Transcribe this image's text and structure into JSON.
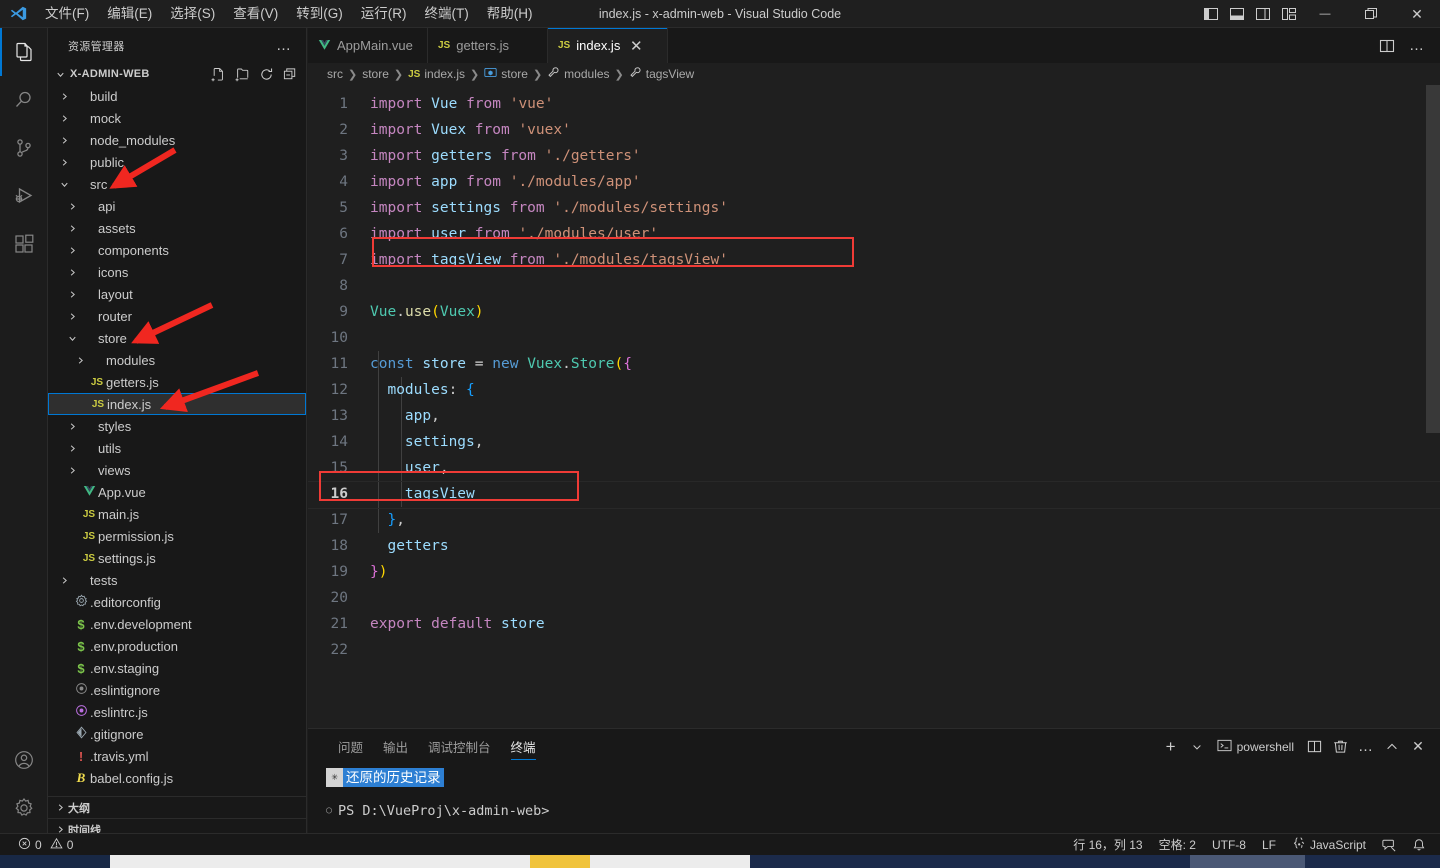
{
  "window": {
    "title": "index.js - x-admin-web - Visual Studio Code",
    "minimize": "—",
    "restore": "❐",
    "close": "✕"
  },
  "menu": {
    "items": [
      {
        "label": "文件(F)"
      },
      {
        "label": "编辑(E)"
      },
      {
        "label": "选择(S)"
      },
      {
        "label": "查看(V)"
      },
      {
        "label": "转到(G)"
      },
      {
        "label": "运行(R)"
      },
      {
        "label": "终端(T)"
      },
      {
        "label": "帮助(H)"
      }
    ]
  },
  "layout_toggles": [
    {
      "name": "toggle-primary-sidebar-icon"
    },
    {
      "name": "toggle-panel-icon"
    },
    {
      "name": "toggle-secondary-sidebar-icon"
    },
    {
      "name": "customize-layout-icon"
    }
  ],
  "activitybar": {
    "items": [
      {
        "name": "explorer",
        "icon": "files-icon",
        "active": true
      },
      {
        "name": "search",
        "icon": "search-icon",
        "active": false
      },
      {
        "name": "source-control",
        "icon": "source-control-icon",
        "active": false
      },
      {
        "name": "run-debug",
        "icon": "run-debug-icon",
        "active": false
      },
      {
        "name": "extensions",
        "icon": "extensions-icon",
        "active": false
      }
    ],
    "bottom": [
      {
        "name": "accounts",
        "icon": "account-icon"
      },
      {
        "name": "manage",
        "icon": "gear-icon"
      }
    ]
  },
  "sidebar": {
    "title": "资源管理器",
    "more_actions": "…",
    "root": {
      "label": "X-ADMIN-WEB",
      "expanded": true,
      "actions": [
        "new-file-icon",
        "new-folder-icon",
        "refresh-icon",
        "collapse-all-icon"
      ]
    },
    "tree": [
      {
        "label": "build",
        "type": "folder",
        "depth": 1,
        "expanded": false
      },
      {
        "label": "mock",
        "type": "folder",
        "depth": 1,
        "expanded": false
      },
      {
        "label": "node_modules",
        "type": "folder",
        "depth": 1,
        "expanded": false
      },
      {
        "label": "public",
        "type": "folder",
        "depth": 1,
        "expanded": false
      },
      {
        "label": "src",
        "type": "folder",
        "depth": 1,
        "expanded": true
      },
      {
        "label": "api",
        "type": "folder",
        "depth": 2,
        "expanded": false
      },
      {
        "label": "assets",
        "type": "folder",
        "depth": 2,
        "expanded": false
      },
      {
        "label": "components",
        "type": "folder",
        "depth": 2,
        "expanded": false
      },
      {
        "label": "icons",
        "type": "folder",
        "depth": 2,
        "expanded": false
      },
      {
        "label": "layout",
        "type": "folder",
        "depth": 2,
        "expanded": false
      },
      {
        "label": "router",
        "type": "folder",
        "depth": 2,
        "expanded": false
      },
      {
        "label": "store",
        "type": "folder",
        "depth": 2,
        "expanded": true
      },
      {
        "label": "modules",
        "type": "folder",
        "depth": 3,
        "expanded": false
      },
      {
        "label": "getters.js",
        "type": "js",
        "depth": 3
      },
      {
        "label": "index.js",
        "type": "js",
        "depth": 3,
        "selected": true
      },
      {
        "label": "styles",
        "type": "folder",
        "depth": 2,
        "expanded": false
      },
      {
        "label": "utils",
        "type": "folder",
        "depth": 2,
        "expanded": false
      },
      {
        "label": "views",
        "type": "folder",
        "depth": 2,
        "expanded": false
      },
      {
        "label": "App.vue",
        "type": "vue",
        "depth": 2
      },
      {
        "label": "main.js",
        "type": "js",
        "depth": 2
      },
      {
        "label": "permission.js",
        "type": "js",
        "depth": 2
      },
      {
        "label": "settings.js",
        "type": "js",
        "depth": 2
      },
      {
        "label": "tests",
        "type": "folder",
        "depth": 1,
        "expanded": false
      },
      {
        "label": ".editorconfig",
        "type": "config",
        "depth": 1
      },
      {
        "label": ".env.development",
        "type": "env",
        "depth": 1
      },
      {
        "label": ".env.production",
        "type": "env",
        "depth": 1
      },
      {
        "label": ".env.staging",
        "type": "env",
        "depth": 1
      },
      {
        "label": ".eslintignore",
        "type": "eslintignore",
        "depth": 1
      },
      {
        "label": ".eslintrc.js",
        "type": "eslint",
        "depth": 1
      },
      {
        "label": ".gitignore",
        "type": "git",
        "depth": 1
      },
      {
        "label": ".travis.yml",
        "type": "travis",
        "depth": 1
      },
      {
        "label": "babel.config.js",
        "type": "babel",
        "depth": 1
      }
    ],
    "bottom_sections": [
      {
        "label": "大纲"
      },
      {
        "label": "时间线"
      }
    ]
  },
  "tabs": [
    {
      "label": "AppMain.vue",
      "type": "vue",
      "active": false
    },
    {
      "label": "getters.js",
      "type": "js",
      "active": false
    },
    {
      "label": "index.js",
      "type": "js",
      "active": true,
      "close": "✕"
    }
  ],
  "tabbar_actions": [
    {
      "name": "split-editor-icon"
    },
    {
      "name": "more-actions-icon",
      "label": "…"
    }
  ],
  "breadcrumb": [
    {
      "label": "src",
      "icon": ""
    },
    {
      "label": "store",
      "icon": ""
    },
    {
      "label": "index.js",
      "icon": "js"
    },
    {
      "label": "store",
      "icon": "module"
    },
    {
      "label": "modules",
      "icon": "property"
    },
    {
      "label": "tagsView",
      "icon": "property"
    }
  ],
  "editor": {
    "active_line": 16,
    "lines": [
      {
        "n": 1,
        "text": "import Vue from 'vue'"
      },
      {
        "n": 2,
        "text": "import Vuex from 'vuex'"
      },
      {
        "n": 3,
        "text": "import getters from './getters'"
      },
      {
        "n": 4,
        "text": "import app from './modules/app'"
      },
      {
        "n": 5,
        "text": "import settings from './modules/settings'"
      },
      {
        "n": 6,
        "text": "import user from './modules/user'"
      },
      {
        "n": 7,
        "text": "import tagsView from './modules/tagsView'"
      },
      {
        "n": 8,
        "text": ""
      },
      {
        "n": 9,
        "text": "Vue.use(Vuex)"
      },
      {
        "n": 10,
        "text": ""
      },
      {
        "n": 11,
        "text": "const store = new Vuex.Store({"
      },
      {
        "n": 12,
        "text": "  modules: {"
      },
      {
        "n": 13,
        "text": "    app,"
      },
      {
        "n": 14,
        "text": "    settings,"
      },
      {
        "n": 15,
        "text": "    user,"
      },
      {
        "n": 16,
        "text": "    tagsView"
      },
      {
        "n": 17,
        "text": "  },"
      },
      {
        "n": 18,
        "text": "  getters"
      },
      {
        "n": 19,
        "text": "})"
      },
      {
        "n": 20,
        "text": ""
      },
      {
        "n": 21,
        "text": "export default store"
      },
      {
        "n": 22,
        "text": ""
      }
    ]
  },
  "annotations": {
    "highlight_boxes": [
      {
        "name": "import-tagsview-highlight",
        "line": 7
      },
      {
        "name": "modules-tagsview-highlight",
        "line": 16
      }
    ],
    "arrows": [
      {
        "name": "arrow-to-src"
      },
      {
        "name": "arrow-to-store"
      },
      {
        "name": "arrow-to-index-js"
      }
    ],
    "color": "#ef3b36"
  },
  "panel": {
    "tabs": [
      {
        "label": "问题",
        "active": false
      },
      {
        "label": "输出",
        "active": false
      },
      {
        "label": "调试控制台",
        "active": false
      },
      {
        "label": "终端",
        "active": true
      }
    ],
    "actions": {
      "new_terminal": "+",
      "dropdown": "⌄",
      "terminal_name": "powershell",
      "split": "split-terminal-icon",
      "kill": "trash-icon",
      "more": "…",
      "maximize": "⌃",
      "close": "✕"
    },
    "terminal": {
      "history_badge_icon": "✳",
      "history_badge_text": "还原的历史记录",
      "prompt": "PS D:\\VueProj\\x-admin-web>"
    }
  },
  "statusbar": {
    "left": [
      {
        "name": "error-count",
        "icon": "error-icon",
        "label": "0"
      },
      {
        "name": "warning-count",
        "icon": "warning-icon",
        "label": "0"
      }
    ],
    "right": [
      {
        "name": "cursor-position",
        "label": "行 16，列 13"
      },
      {
        "name": "indentation",
        "label": "空格: 2"
      },
      {
        "name": "encoding",
        "label": "UTF-8"
      },
      {
        "name": "eol",
        "label": "LF"
      },
      {
        "name": "language-mode",
        "label": "JavaScript",
        "icon": "brace-icon"
      },
      {
        "name": "feedback",
        "icon": "feedback-icon",
        "label": ""
      },
      {
        "name": "notifications",
        "icon": "bell-icon",
        "label": ""
      }
    ]
  },
  "colors": {
    "accent": "#0078d4",
    "annotation_red": "#ef3b36",
    "editor_bg": "#1f1f1f",
    "sidebar_bg": "#181818",
    "keyword": "#c586c0",
    "identifier": "#9cdcfe",
    "string": "#ce9178",
    "function": "#dcdcaa",
    "class": "#4ec9b0",
    "control": "#569cd6"
  }
}
